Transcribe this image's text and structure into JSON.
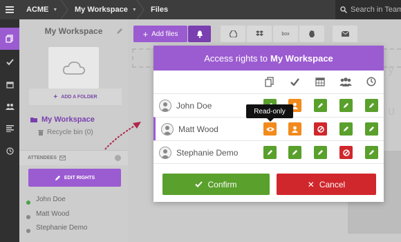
{
  "topbar": {
    "org": "ACME",
    "workspace": "My Workspace",
    "section": "Files",
    "search_placeholder": "Search in TeamS"
  },
  "nav": {
    "items": [
      "files-icon",
      "check-icon",
      "calendar-icon",
      "users-icon",
      "list-icon",
      "clock-icon"
    ],
    "active_index": 0
  },
  "sidebar": {
    "title": "My Workspace",
    "add_folder_label": "ADD A FOLDER",
    "tree": {
      "workspace_label": "My Workspace",
      "recycle_label": "Recycle bin (0)"
    },
    "attendees_label": "ATTENDEES",
    "edit_rights_label": "EDIT RIGHTS",
    "attendees": [
      {
        "name": "John Doe",
        "online": true
      },
      {
        "name": "Matt Wood",
        "online": false
      },
      {
        "name": "Stephanie Demo",
        "online": false
      }
    ]
  },
  "toolbar": {
    "add_files_label": "Add files",
    "icons": [
      "bell-icon",
      "google-drive-icon",
      "dropbox-icon",
      "box-icon",
      "evernote-icon",
      "mail-icon"
    ],
    "box_label": "box"
  },
  "modal": {
    "title_prefix": "Access rights to",
    "title_workspace": "My Workspace",
    "columns": [
      "files-icon",
      "tasks-icon",
      "calendar-icon",
      "users-icon",
      "timesheet-icon"
    ],
    "rows": [
      {
        "name": "John Doe",
        "perms": [
          "edit",
          "user",
          "edit",
          "edit",
          "edit"
        ]
      },
      {
        "name": "Matt Wood",
        "perms": [
          "read",
          "user",
          "none",
          "edit",
          "edit"
        ]
      },
      {
        "name": "Stephanie Demo",
        "perms": [
          "edit",
          "edit",
          "edit",
          "none",
          "edit"
        ]
      }
    ],
    "selected_row": 1,
    "tooltip": "Read-only",
    "confirm_label": "Confirm",
    "cancel_label": "Cancel"
  },
  "colors": {
    "accent": "#9b5bd1",
    "accent_dark": "#7a3fb0",
    "edit": "#5aa02c",
    "user": "#f28a1c",
    "none": "#d0272c"
  }
}
